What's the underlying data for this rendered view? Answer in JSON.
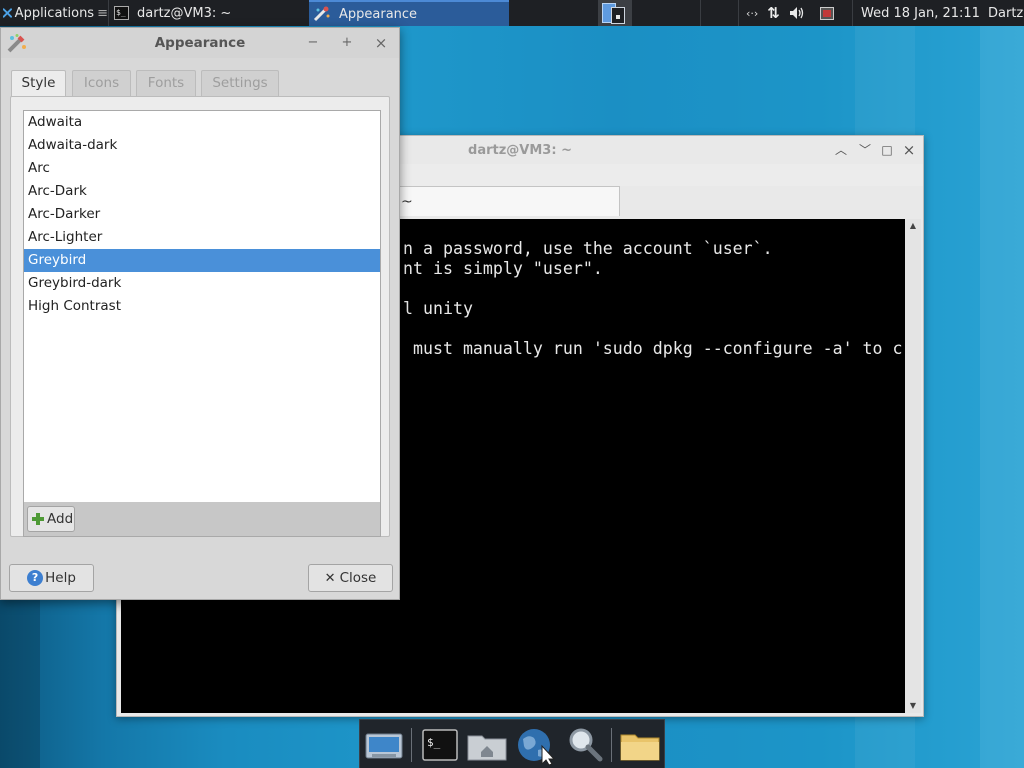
{
  "top_panel": {
    "app_menu_label": "Applications",
    "tasks": [
      {
        "label": "dartz@VM3: ~"
      },
      {
        "label": "Appearance"
      }
    ],
    "clock": "Wed 18 Jan, 21:11",
    "user": "Dartz",
    "tray_icons": [
      "network-arrows-icon",
      "transfer-icon",
      "volume-icon",
      "record-icon"
    ]
  },
  "terminal": {
    "title": "dartz@VM3: ~",
    "tab_label": "~",
    "lines": [
      "n a password, use the account `user`.",
      "nt is simply \"user\".",
      "",
      "l unity",
      "",
      " must manually run 'sudo dpkg --configure -a' to c"
    ]
  },
  "appearance": {
    "title": "Appearance",
    "tabs": [
      {
        "label": "Style",
        "active": true
      },
      {
        "label": "Icons",
        "active": false
      },
      {
        "label": "Fonts",
        "active": false
      },
      {
        "label": "Settings",
        "active": false
      }
    ],
    "themes": [
      "Adwaita",
      "Adwaita-dark",
      "Arc",
      "Arc-Dark",
      "Arc-Darker",
      "Arc-Lighter",
      "Greybird",
      "Greybird-dark",
      "High Contrast"
    ],
    "selected_theme": "Greybird",
    "add_label": "Add",
    "help_label": "Help",
    "close_label": "Close",
    "minimize_glyph": "−",
    "maximize_glyph": "+",
    "close_glyph": "×"
  },
  "dock": {
    "items": [
      "display-icon",
      "terminal-icon",
      "home-folder-icon",
      "web-browser-icon",
      "search-icon",
      "files-icon"
    ]
  },
  "colors": {
    "selection": "#4a90d9",
    "panel": "#1e2024",
    "active_task": "#2b5c9a",
    "desktop": "#1a8cc0"
  }
}
